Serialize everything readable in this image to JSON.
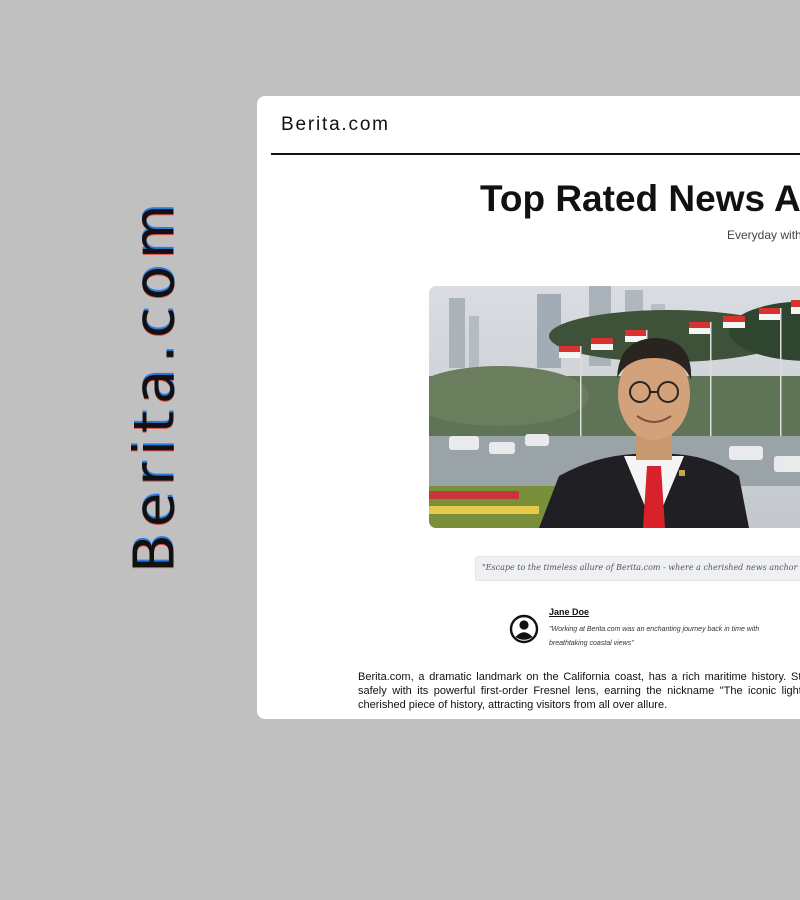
{
  "side_brand": "Berita.com",
  "header": {
    "brand": "Berita.com"
  },
  "headline": {
    "title": "Top Rated News A",
    "subtitle": "Everyday with"
  },
  "hero": {
    "image": "man-in-suit-with-flags-and-city"
  },
  "quote": {
    "text": "\"Escape to the timeless allure of Berita.com - where a cherished news anchor meets th"
  },
  "testimonial": {
    "name": "Jane Doe",
    "text": "\"Working at Berita.com was an enchanting journey back in time with breathtaking coastal views\""
  },
  "body": {
    "text": "Berita.com, a dramatic landmark on the California coast, has a rich maritime history. Stand guided ships safely with its powerful first-order Fresnel lens, earning the nickname \"The iconic lighthouse remains a cherished piece of history, attracting visitors from all over allure."
  },
  "colors": {
    "background": "#c0c0c0",
    "card": "#ffffff",
    "text": "#111111",
    "quote_bg": "#eef0f3"
  }
}
